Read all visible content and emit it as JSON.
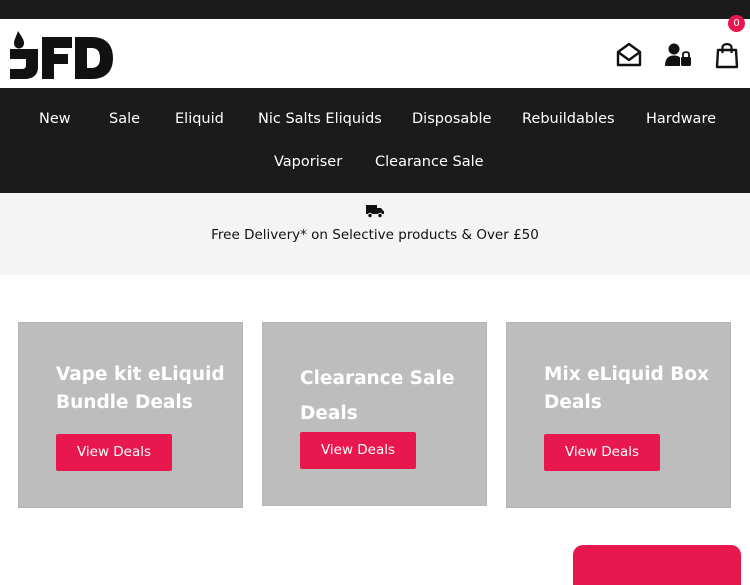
{
  "header": {
    "logo_text": "JFD",
    "cart_count": "0",
    "icons": [
      "mail-icon",
      "account-lock-icon",
      "shopping-bag-icon"
    ]
  },
  "nav": {
    "items": [
      {
        "label": "New"
      },
      {
        "label": "Sale"
      },
      {
        "label": "Eliquid"
      },
      {
        "label": "Nic Salts Eliquids"
      },
      {
        "label": "Disposable"
      },
      {
        "label": "Rebuildables"
      },
      {
        "label": "Hardware"
      },
      {
        "label": "Vaporiser"
      },
      {
        "label": "Clearance Sale"
      }
    ]
  },
  "promo": {
    "icon": "truck-icon",
    "text": "Free Delivery* on Selective products & Over £50"
  },
  "cards": [
    {
      "title": "Vape kit eLiquid Bundle Deals",
      "button": "View Deals"
    },
    {
      "title": "Clearance Sale Deals",
      "button": "View Deals"
    },
    {
      "title": "Mix eLiquid Box Deals",
      "button": "View Deals"
    }
  ],
  "colors": {
    "accent": "#e8174e",
    "dark": "#1b1b1b",
    "card_bg": "#bdbdbd",
    "promo_bg": "#f4f4f4"
  }
}
